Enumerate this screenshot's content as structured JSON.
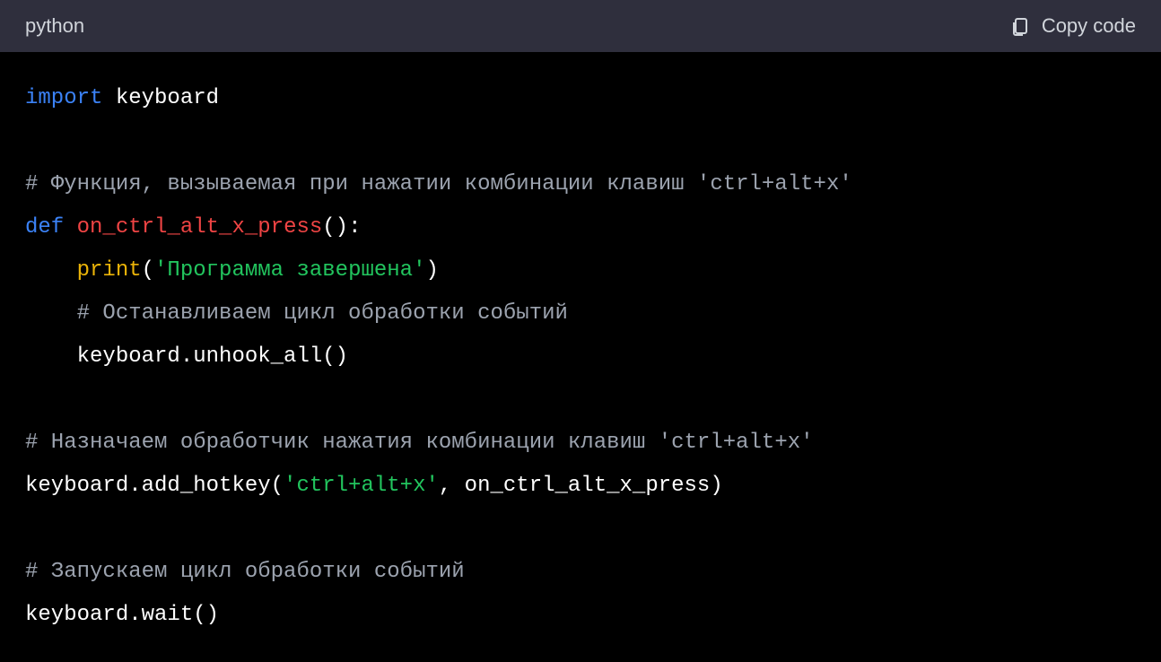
{
  "header": {
    "language": "python",
    "copy_label": "Copy code"
  },
  "code": {
    "tokens": [
      [
        {
          "cls": "tok-keyword",
          "text": "import"
        },
        {
          "cls": "tok-plain",
          "text": " keyboard"
        }
      ],
      [],
      [
        {
          "cls": "tok-comment",
          "text": "# Функция, вызываемая при нажатии комбинации клавиш 'ctrl+alt+x'"
        }
      ],
      [
        {
          "cls": "tok-def",
          "text": "def"
        },
        {
          "cls": "tok-plain",
          "text": " "
        },
        {
          "cls": "tok-funcname",
          "text": "on_ctrl_alt_x_press"
        },
        {
          "cls": "tok-plain",
          "text": "():"
        }
      ],
      [
        {
          "cls": "tok-plain",
          "text": "    "
        },
        {
          "cls": "tok-builtin",
          "text": "print"
        },
        {
          "cls": "tok-plain",
          "text": "("
        },
        {
          "cls": "tok-string",
          "text": "'Программа завершена'"
        },
        {
          "cls": "tok-plain",
          "text": ")"
        }
      ],
      [
        {
          "cls": "tok-plain",
          "text": "    "
        },
        {
          "cls": "tok-comment",
          "text": "# Останавливаем цикл обработки событий"
        }
      ],
      [
        {
          "cls": "tok-plain",
          "text": "    keyboard.unhook_all()"
        }
      ],
      [],
      [
        {
          "cls": "tok-comment",
          "text": "# Назначаем обработчик нажатия комбинации клавиш 'ctrl+alt+x'"
        }
      ],
      [
        {
          "cls": "tok-plain",
          "text": "keyboard.add_hotkey("
        },
        {
          "cls": "tok-string",
          "text": "'ctrl+alt+x'"
        },
        {
          "cls": "tok-plain",
          "text": ", on_ctrl_alt_x_press)"
        }
      ],
      [],
      [
        {
          "cls": "tok-comment",
          "text": "# Запускаем цикл обработки событий"
        }
      ],
      [
        {
          "cls": "tok-plain",
          "text": "keyboard.wait()"
        }
      ]
    ]
  }
}
